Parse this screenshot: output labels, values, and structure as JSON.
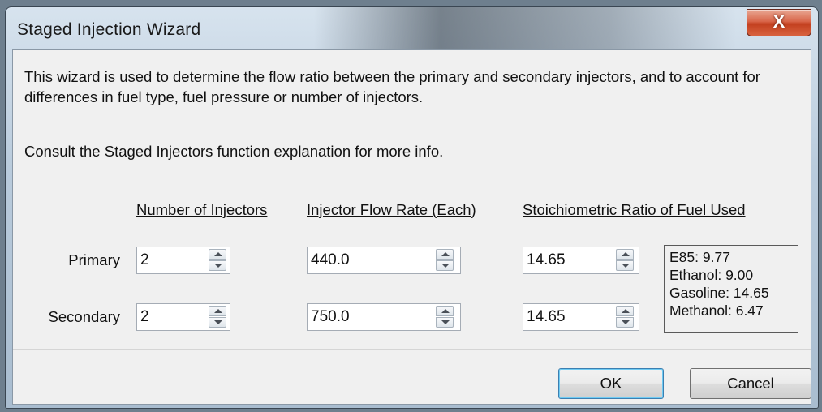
{
  "window": {
    "title": "Staged Injection Wizard",
    "close_glyph": "X"
  },
  "intro_text": "This wizard is used to determine the flow ratio between the primary and secondary injectors, and to account for differences in fuel type, fuel pressure or number of injectors.",
  "consult_text": "Consult the Staged Injectors function explanation for more info.",
  "columns": {
    "injectors": "Number of Injectors",
    "flow": "Injector Flow Rate (Each)",
    "stoich": "Stoichiometric Ratio of Fuel Used"
  },
  "rows": [
    {
      "label": "Primary",
      "injectors": "2",
      "flow": "440.0",
      "stoich": "14.65"
    },
    {
      "label": "Secondary",
      "injectors": "2",
      "flow": "750.0",
      "stoich": "14.65"
    }
  ],
  "fuel_reference": [
    "E85: 9.77",
    "Ethanol: 9.00",
    "Gasoline: 14.65",
    "Methanol: 6.47"
  ],
  "buttons": {
    "ok": "OK",
    "cancel": "Cancel"
  }
}
